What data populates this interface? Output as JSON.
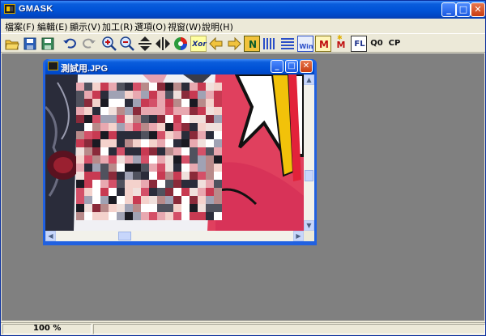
{
  "window": {
    "title": "GMASK"
  },
  "menu": {
    "items": [
      "檔案(F)",
      "編輯(E)",
      "顯示(V)",
      "加工(R)",
      "選項(O)",
      "視窗(W)",
      "說明(H)"
    ]
  },
  "toolbar": {
    "buttons": [
      {
        "name": "open-icon"
      },
      {
        "name": "save-icon"
      },
      {
        "name": "save-as-icon"
      },
      {
        "name": "undo-icon"
      },
      {
        "name": "redo-icon"
      },
      {
        "name": "zoom-in-icon"
      },
      {
        "name": "zoom-out-icon"
      },
      {
        "name": "flip-vertical-icon"
      },
      {
        "name": "flip-horizontal-icon"
      },
      {
        "name": "color-wheel-icon"
      },
      {
        "name": "xor-icon",
        "label": "Xor"
      },
      {
        "name": "shift-left-icon"
      },
      {
        "name": "shift-right-icon"
      },
      {
        "name": "nega-icon",
        "label": "N"
      },
      {
        "name": "vertical-glass-icon"
      },
      {
        "name": "horizontal-glass-icon"
      },
      {
        "name": "win-icon",
        "label": "Win"
      },
      {
        "name": "meko-icon",
        "label": "M"
      },
      {
        "name": "meko-plus-icon",
        "label": "M"
      },
      {
        "name": "fl-icon",
        "label": "FL"
      },
      {
        "name": "q0-icon",
        "label": "Q0"
      },
      {
        "name": "cp-icon",
        "label": "CP"
      }
    ]
  },
  "child_window": {
    "title": "測試用.JPG"
  },
  "status": {
    "zoom": "100 %"
  },
  "colors": {
    "titlebar": "#0052d6",
    "close": "#c83d12",
    "workspace": "#808080",
    "chrome": "#ece9d8"
  }
}
